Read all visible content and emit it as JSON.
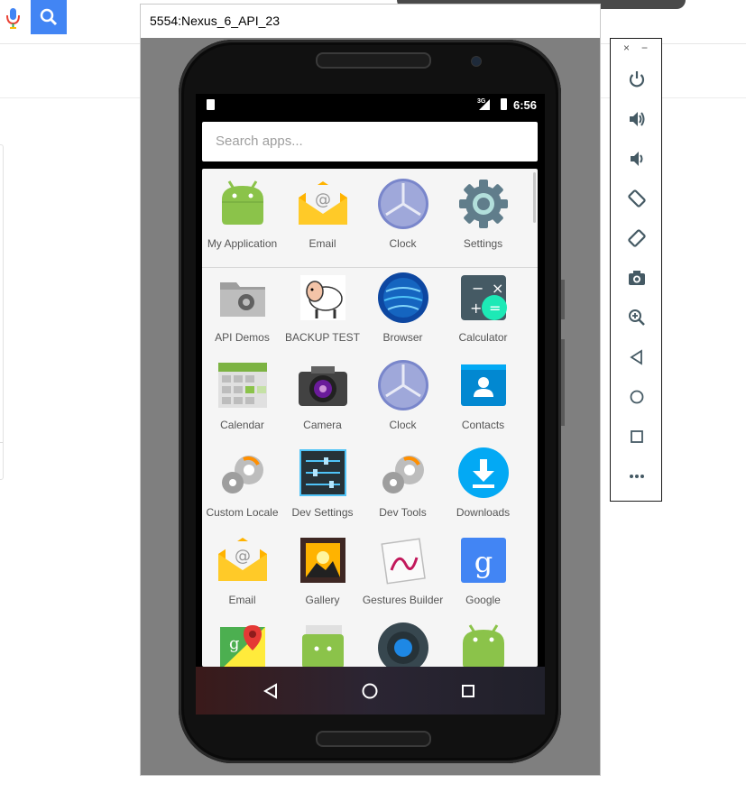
{
  "browser": {
    "icons": [
      "microphone-icon",
      "search-icon"
    ],
    "accent": "#4285f4"
  },
  "emulator": {
    "title": "5554:Nexus_6_API_23",
    "status_bar": {
      "network": "3G",
      "time": "6:56"
    },
    "search": {
      "placeholder": "Search apps..."
    },
    "predicted_apps": [
      {
        "label": "My Application",
        "icon": "android-icon"
      },
      {
        "label": "Email",
        "icon": "email-icon"
      },
      {
        "label": "Clock",
        "icon": "clock-icon"
      },
      {
        "label": "Settings",
        "icon": "settings-gear-icon"
      }
    ],
    "apps": [
      {
        "label": "API Demos",
        "icon": "folder-gear-icon"
      },
      {
        "label": "BACKUP TEST",
        "icon": "sheep-icon"
      },
      {
        "label": "Browser",
        "icon": "globe-icon"
      },
      {
        "label": "Calculator",
        "icon": "calculator-icon"
      },
      {
        "label": "Calendar",
        "icon": "calendar-icon"
      },
      {
        "label": "Camera",
        "icon": "camera-icon"
      },
      {
        "label": "Clock",
        "icon": "clock-icon"
      },
      {
        "label": "Contacts",
        "icon": "contacts-icon"
      },
      {
        "label": "Custom Locale",
        "icon": "gears-icon"
      },
      {
        "label": "Dev Settings",
        "icon": "sliders-icon"
      },
      {
        "label": "Dev Tools",
        "icon": "gears-icon"
      },
      {
        "label": "Downloads",
        "icon": "download-icon"
      },
      {
        "label": "Email",
        "icon": "email-icon"
      },
      {
        "label": "Gallery",
        "icon": "gallery-icon"
      },
      {
        "label": "Gestures Builder",
        "icon": "gestures-icon"
      },
      {
        "label": "Google",
        "icon": "google-icon"
      },
      {
        "label": "",
        "icon": "maps-icon"
      },
      {
        "label": "",
        "icon": "messaging-icon"
      },
      {
        "label": "",
        "icon": "music-icon"
      },
      {
        "label": "",
        "icon": "android-icon"
      }
    ],
    "nav_buttons": [
      "back-icon",
      "home-icon",
      "recents-icon"
    ]
  },
  "toolbar": {
    "window_controls": [
      "close-icon",
      "minimize-icon"
    ],
    "close_glyph": "×",
    "minimize_glyph": "−",
    "buttons": [
      {
        "name": "power-button",
        "icon": "power-icon"
      },
      {
        "name": "volume-up-button",
        "icon": "volume-up-icon"
      },
      {
        "name": "volume-down-button",
        "icon": "volume-down-icon"
      },
      {
        "name": "rotate-left-button",
        "icon": "rotate-left-icon"
      },
      {
        "name": "rotate-right-button",
        "icon": "rotate-right-icon"
      },
      {
        "name": "screenshot-button",
        "icon": "camera-icon"
      },
      {
        "name": "zoom-button",
        "icon": "zoom-in-icon"
      },
      {
        "name": "back-button",
        "icon": "back-icon"
      },
      {
        "name": "home-button",
        "icon": "home-icon"
      },
      {
        "name": "overview-button",
        "icon": "recents-icon"
      },
      {
        "name": "more-button",
        "icon": "more-icon"
      }
    ]
  }
}
